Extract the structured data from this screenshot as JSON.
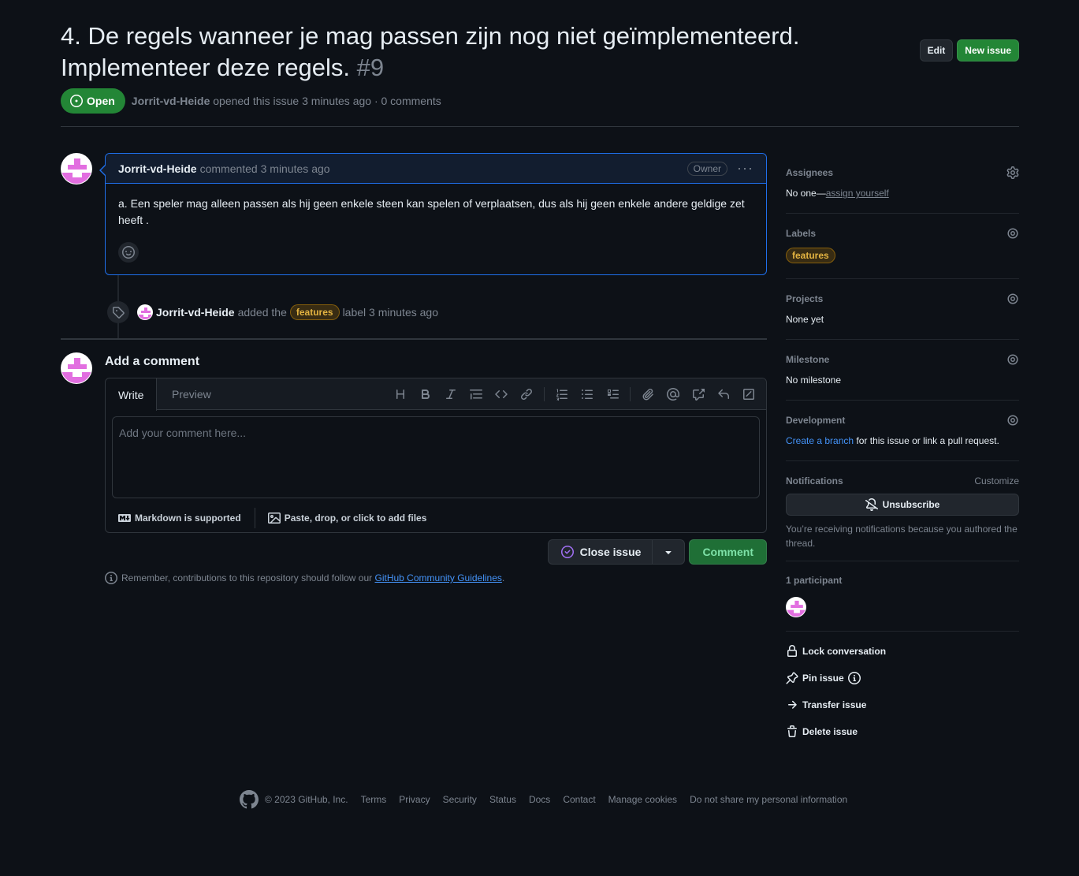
{
  "issue": {
    "title": "4. De regels wanneer je mag passen zijn nog niet geïmplementeerd. Implementeer deze regels.",
    "number": "#9",
    "state": "Open",
    "author": "Jorrit-vd-Heide",
    "meta_text": "opened this issue 3 minutes ago · 0 comments"
  },
  "header_actions": {
    "edit": "Edit",
    "new_issue": "New issue"
  },
  "comment": {
    "author": "Jorrit-vd-Heide",
    "action": "commented 3 minutes ago",
    "role": "Owner",
    "body": "a. Een speler mag alleen passen als hij geen enkele steen kan spelen of verplaatsen, dus als hij geen enkele andere geldige zet heeft ."
  },
  "event": {
    "actor": "Jorrit-vd-Heide",
    "pre": "added the",
    "label": "features",
    "post": "label 3 minutes ago"
  },
  "composer": {
    "title": "Add a comment",
    "tab_write": "Write",
    "tab_preview": "Preview",
    "placeholder": "Add your comment here...",
    "markdown_note": "Markdown is supported",
    "files_note": "Paste, drop, or click to add files",
    "close_label": "Close issue",
    "comment_label": "Comment",
    "guidelines_pre": "Remember, contributions to this repository should follow our",
    "guidelines_link": "GitHub Community Guidelines",
    "guidelines_post": "."
  },
  "sidebar": {
    "assignees": {
      "heading": "Assignees",
      "value_pre": "No one—",
      "value_link": "assign yourself"
    },
    "labels": {
      "heading": "Labels",
      "label": "features"
    },
    "projects": {
      "heading": "Projects",
      "value": "None yet"
    },
    "milestone": {
      "heading": "Milestone",
      "value": "No milestone"
    },
    "development": {
      "heading": "Development",
      "link": "Create a branch",
      "value": "for this issue or link a pull request."
    },
    "notifications": {
      "heading": "Notifications",
      "customize": "Customize",
      "button": "Unsubscribe",
      "note": "You’re receiving notifications because you authored the thread."
    },
    "participants": {
      "heading": "1 participant"
    },
    "actions": {
      "lock": "Lock conversation",
      "pin": "Pin issue",
      "transfer": "Transfer issue",
      "delete": "Delete issue"
    }
  },
  "footer": {
    "copyright": "© 2023 GitHub, Inc.",
    "links": [
      "Terms",
      "Privacy",
      "Security",
      "Status",
      "Docs",
      "Contact",
      "Manage cookies",
      "Do not share my personal information"
    ]
  },
  "colors": {
    "open_green": "#238636",
    "label_yellow": "#e3b341",
    "link_blue": "#4493f8",
    "avatar_pink": "#e26ee0"
  }
}
